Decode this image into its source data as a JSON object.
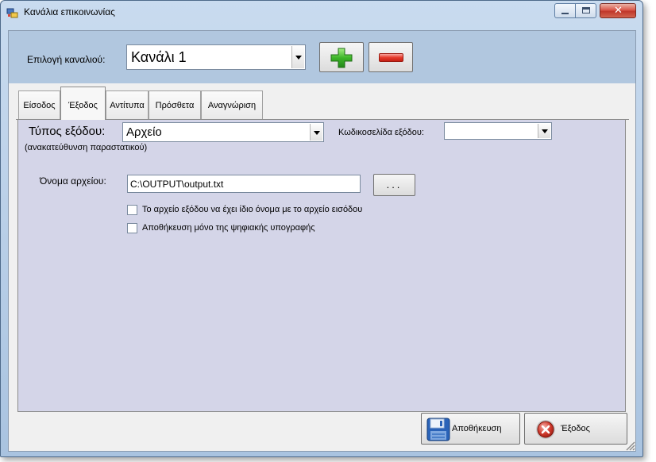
{
  "window": {
    "title": "Κανάλια επικοινωνίας",
    "close_symbol": "✕"
  },
  "top": {
    "channel_label": "Επιλογή καναλιού:",
    "channel_value": "Κανάλι 1"
  },
  "tabs": [
    {
      "label": "Είσοδος"
    },
    {
      "label": "Έξοδος"
    },
    {
      "label": "Αντίτυπα"
    },
    {
      "label": "Πρόσθετα"
    },
    {
      "label": "Αναγνώριση"
    }
  ],
  "output": {
    "type_label": "Τύπος εξόδου:",
    "type_value": "Αρχείο",
    "type_sublabel": "(ανακατεύθυνση παραστατικού)",
    "codepage_label": "Κωδικοσελίδα εξόδου:",
    "codepage_value": "",
    "filename_label": "Όνομα αρχείου:",
    "filename_value": "C:\\OUTPUT\\output.txt",
    "browse_label": "...",
    "option1_label": "Το αρχείο εξόδου να έχει ίδιο όνομα με το αρχείο εισόδου",
    "option2_label": "Αποθήκευση μόνο της ψηφιακής υπογραφής"
  },
  "bottom": {
    "save_label": "Αποθήκευση",
    "exit_label": "Έξοδος"
  },
  "colors": {
    "top_panel": "#b1c7df",
    "tab_page": "#d4d5e8",
    "add_green": "#3cb528",
    "remove_red": "#e53a2b"
  }
}
